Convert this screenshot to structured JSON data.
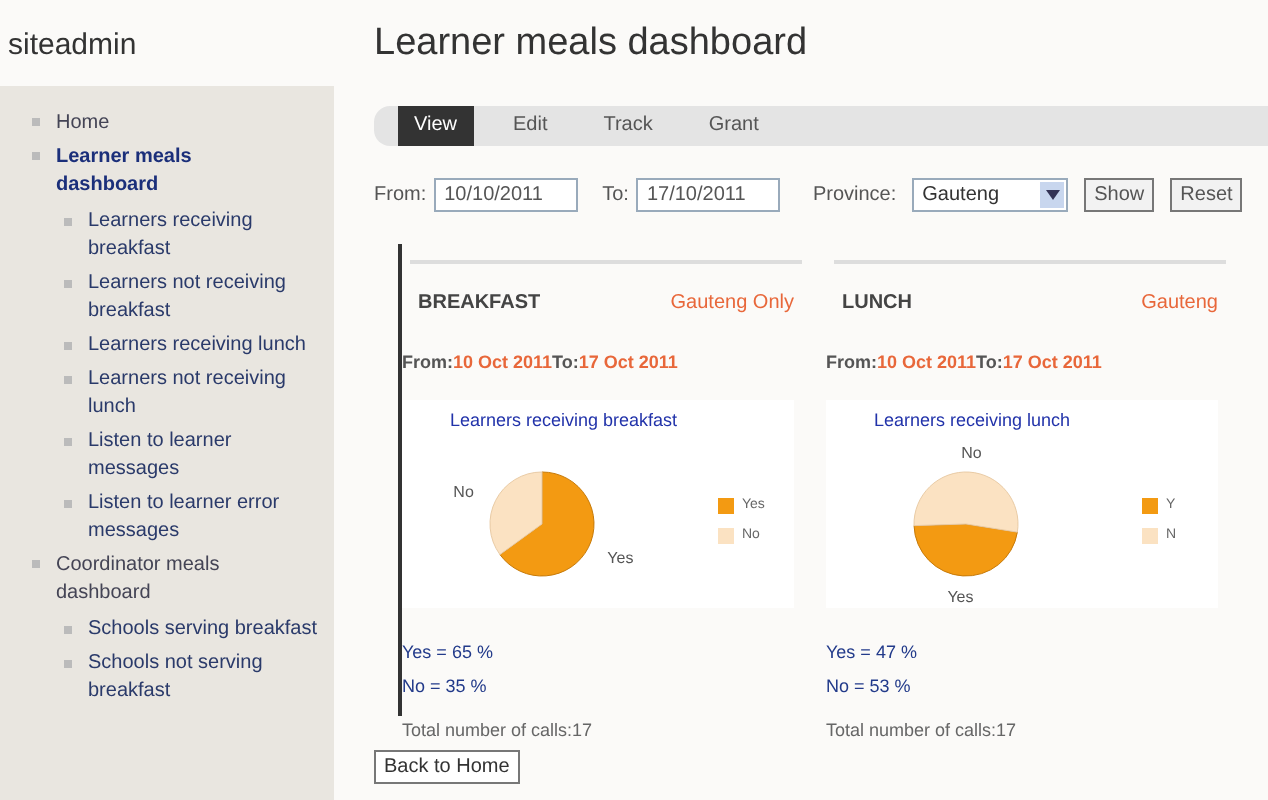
{
  "site": {
    "name": "siteadmin"
  },
  "sidebar": {
    "items": [
      {
        "label": "Home",
        "active": false
      },
      {
        "label": "Learner meals dashboard",
        "active": true,
        "children": [
          {
            "label": "Learners receiving breakfast",
            "active": false
          },
          {
            "label": "Learners not receiving breakfast",
            "active": false
          },
          {
            "label": "Learners receiving lunch",
            "active": false
          },
          {
            "label": "Learners not receiving lunch",
            "active": false
          },
          {
            "label": "Listen to learner messages",
            "active": false
          },
          {
            "label": "Listen to learner error messages",
            "active": false
          }
        ]
      },
      {
        "label": "Coordinator meals dashboard",
        "active": false,
        "children": [
          {
            "label": "Schools serving breakfast",
            "active": false
          },
          {
            "label": "Schools not serving breakfast",
            "active": false
          }
        ]
      }
    ]
  },
  "page": {
    "title": "Learner meals dashboard"
  },
  "tabs": [
    {
      "label": "View",
      "selected": true
    },
    {
      "label": "Edit",
      "selected": false
    },
    {
      "label": "Track",
      "selected": false
    },
    {
      "label": "Grant",
      "selected": false
    }
  ],
  "filters": {
    "from_label": "From:",
    "from_value": "10/10/2011",
    "to_label": "To:",
    "to_value": "17/10/2011",
    "province_label": "Province:",
    "province_value": "Gauteng",
    "show_button": "Show",
    "reset_button": "Reset"
  },
  "panels": [
    {
      "heading": "BREAKFAST",
      "region": "Gauteng Only",
      "from_label": "From:",
      "from_date": "10 Oct 2011",
      "to_label": "To:",
      "to_date": "17 Oct 2011",
      "legend": [
        "Yes",
        "No"
      ],
      "yes_text": "Yes = 65 %",
      "no_text": "No = 35 %",
      "total_text": "Total number of calls:17",
      "chart_data": {
        "type": "pie",
        "title": "Learners receiving breakfast",
        "categories": [
          "Yes",
          "No"
        ],
        "series": [
          {
            "values": [
              65,
              35
            ]
          }
        ]
      }
    },
    {
      "heading": "LUNCH",
      "region": "Gauteng",
      "from_label": "From:",
      "from_date": "10 Oct 2011",
      "to_label": "To:",
      "to_date": "17 Oct 2011",
      "legend": [
        "Y",
        "N"
      ],
      "yes_text": "Yes = 47 %",
      "no_text": "No = 53 %",
      "total_text": "Total number of calls:17",
      "chart_data": {
        "type": "pie",
        "title": "Learners receiving lunch",
        "categories": [
          "Yes",
          "No"
        ],
        "series": [
          {
            "values": [
              47,
              53
            ]
          }
        ]
      }
    }
  ],
  "back_button": "Back to Home"
}
